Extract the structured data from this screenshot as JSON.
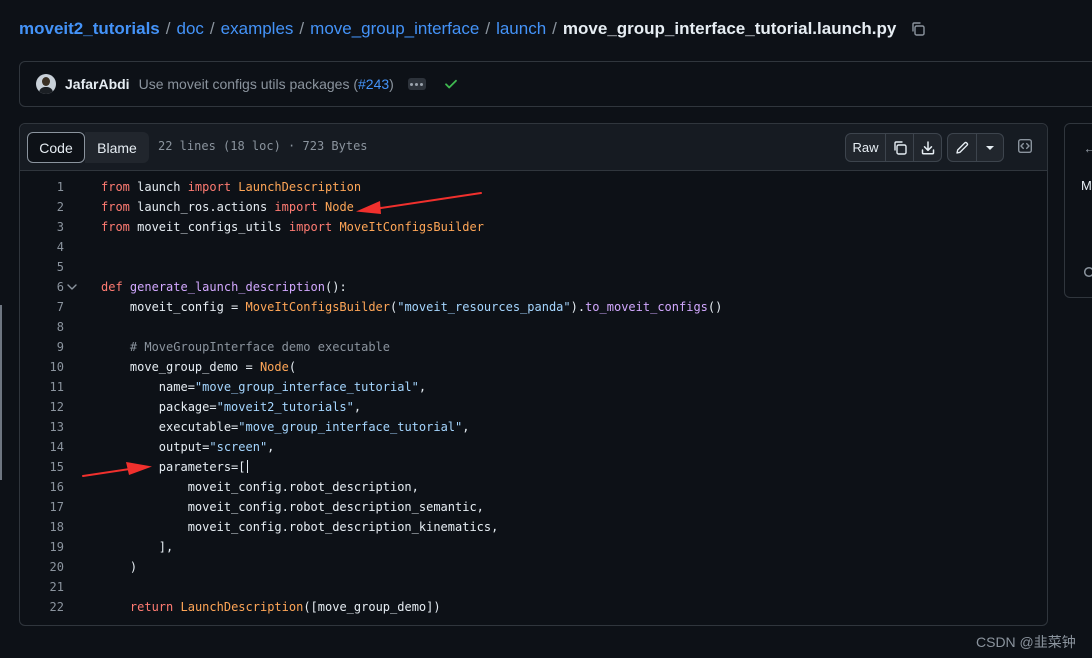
{
  "breadcrumb": {
    "repo": "moveit2_tutorials",
    "parts": [
      "doc",
      "examples",
      "move_group_interface",
      "launch"
    ],
    "separator": "/",
    "file": "move_group_interface_tutorial.launch.py"
  },
  "commit": {
    "author": "JafarAbdi",
    "message": "Use moveit configs utils packages (",
    "pr_link": "#243",
    "message_end": ")",
    "status": "success"
  },
  "toolbar": {
    "code_tab": "Code",
    "blame_tab": "Blame",
    "file_info": "22 lines (18 loc) · 723 Bytes",
    "raw_label": "Raw"
  },
  "code": {
    "language": "python",
    "lines": [
      {
        "n": "1",
        "text": "from launch import LaunchDescription"
      },
      {
        "n": "2",
        "text": "from launch_ros.actions import Node"
      },
      {
        "n": "3",
        "text": "from moveit_configs_utils import MoveItConfigsBuilder"
      },
      {
        "n": "4",
        "text": ""
      },
      {
        "n": "5",
        "text": ""
      },
      {
        "n": "6",
        "text": "def generate_launch_description():"
      },
      {
        "n": "7",
        "text": "    moveit_config = MoveItConfigsBuilder(\"moveit_resources_panda\").to_moveit_configs()"
      },
      {
        "n": "8",
        "text": ""
      },
      {
        "n": "9",
        "text": "    # MoveGroupInterface demo executable"
      },
      {
        "n": "10",
        "text": "    move_group_demo = Node("
      },
      {
        "n": "11",
        "text": "        name=\"move_group_interface_tutorial\","
      },
      {
        "n": "12",
        "text": "        package=\"moveit2_tutorials\","
      },
      {
        "n": "13",
        "text": "        executable=\"move_group_interface_tutorial\","
      },
      {
        "n": "14",
        "text": "        output=\"screen\","
      },
      {
        "n": "15",
        "text": "        parameters=["
      },
      {
        "n": "16",
        "text": "            moveit_config.robot_description,"
      },
      {
        "n": "17",
        "text": "            moveit_config.robot_description_semantic,"
      },
      {
        "n": "18",
        "text": "            moveit_config.robot_description_kinematics,"
      },
      {
        "n": "19",
        "text": "        ],"
      },
      {
        "n": "20",
        "text": "    )"
      },
      {
        "n": "21",
        "text": ""
      },
      {
        "n": "22",
        "text": "    return LaunchDescription([move_group_demo])"
      }
    ]
  },
  "side_panel": {
    "text": "Mo"
  },
  "watermark": "CSDN @韭菜钟",
  "colors": {
    "background": "#0d1117",
    "link": "#4493f8",
    "keyword": "#ff7b72",
    "function": "#d2a8ff",
    "class": "#ffa657",
    "string": "#a5d6ff",
    "comment": "#8b949e",
    "annotation_arrow": "#f0302d"
  }
}
